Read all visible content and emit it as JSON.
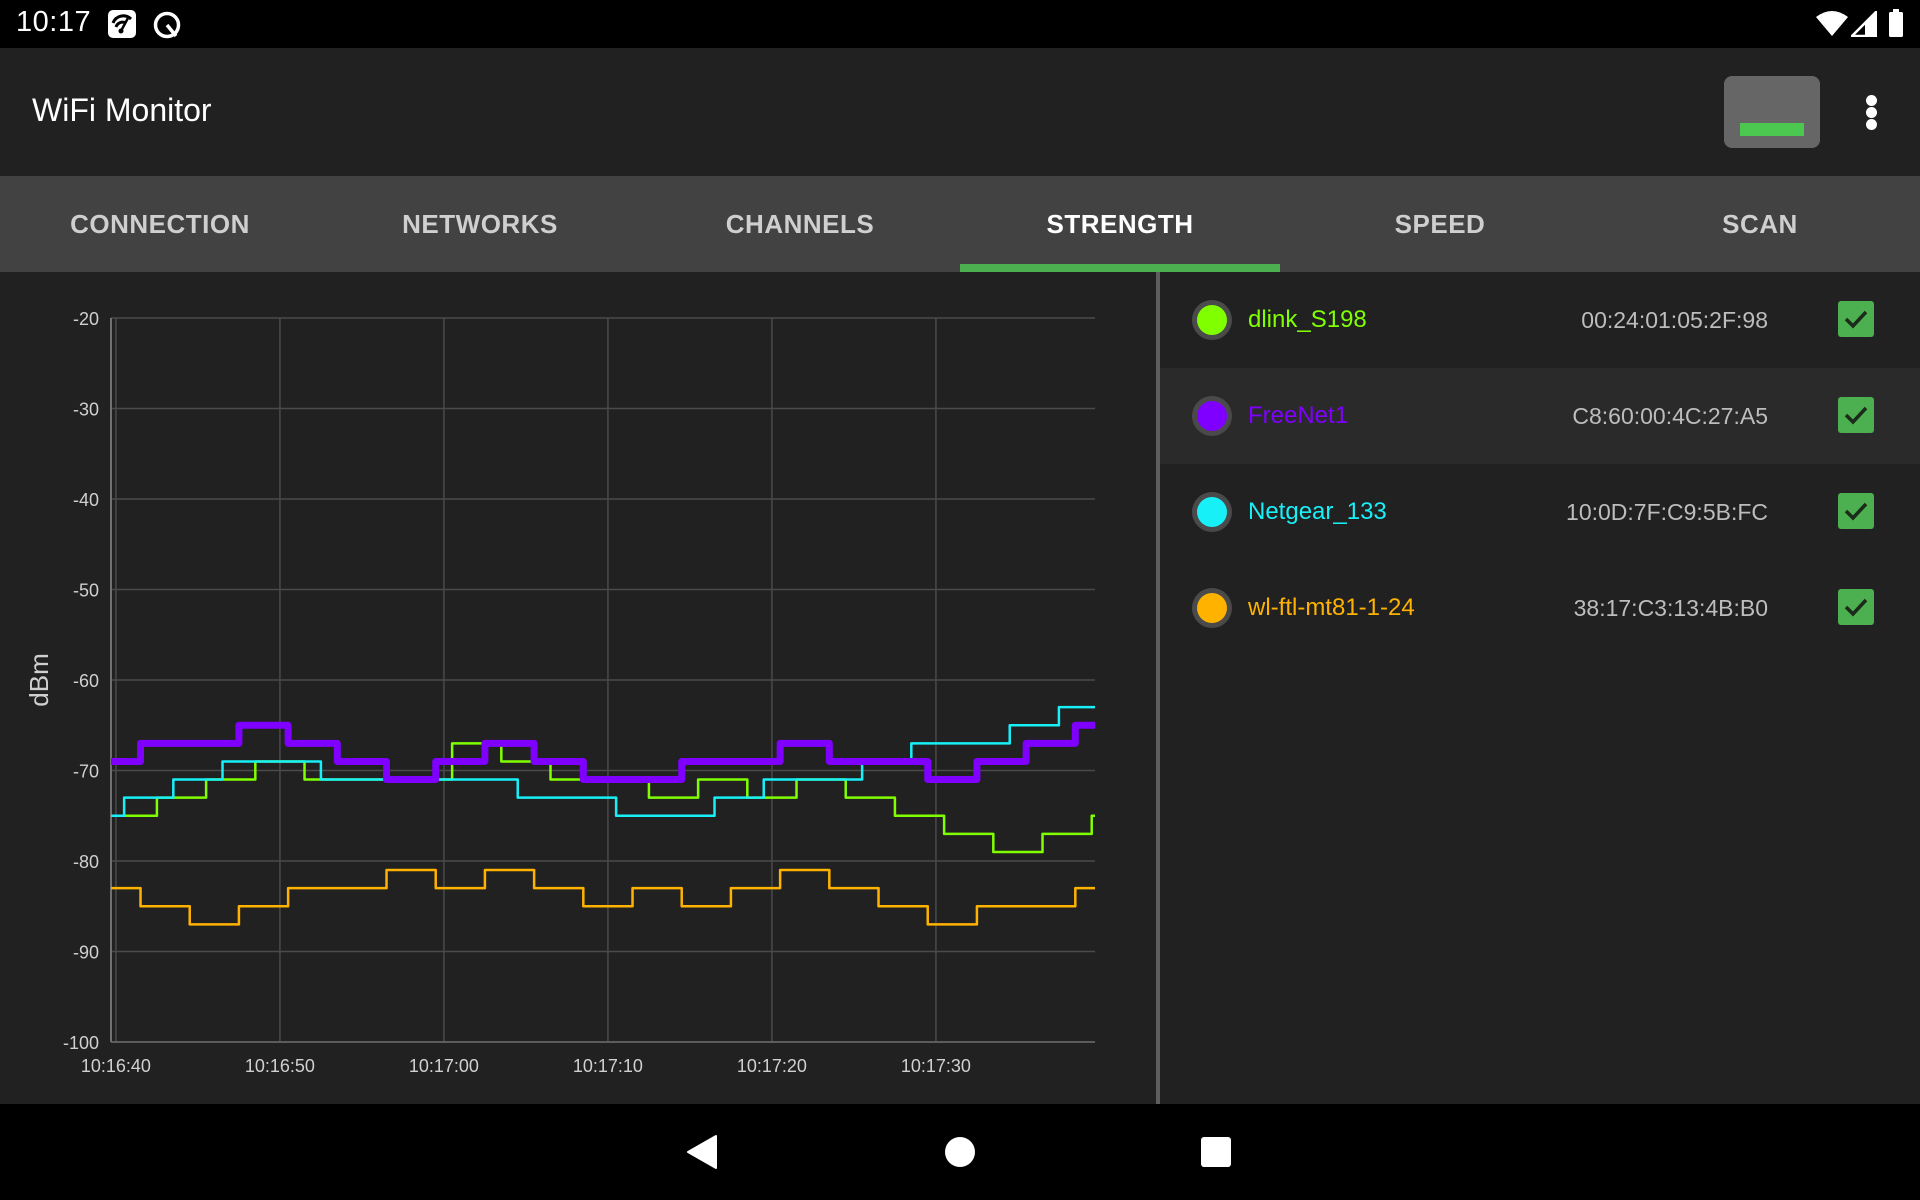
{
  "status_bar": {
    "time": "10:17",
    "left_icons": [
      "speedtest-icon",
      "q-launcher-icon"
    ],
    "right_icons": [
      "wifi-signal-icon",
      "cell-signal-icon",
      "battery-icon"
    ]
  },
  "app_bar": {
    "title": "WiFi Monitor",
    "actions": [
      {
        "name": "signal-strength-indicator",
        "icon": "strength-bar-icon",
        "accent": "#4cc850"
      },
      {
        "name": "overflow-menu",
        "icon": "more-vert-icon"
      }
    ]
  },
  "tabs": [
    {
      "label": "CONNECTION",
      "active": false
    },
    {
      "label": "NETWORKS",
      "active": false
    },
    {
      "label": "CHANNELS",
      "active": false
    },
    {
      "label": "STRENGTH",
      "active": true
    },
    {
      "label": "SPEED",
      "active": false
    },
    {
      "label": "SCAN",
      "active": false
    }
  ],
  "accent_color": "#4caf50",
  "networks": [
    {
      "ssid": "dlink_S198",
      "bssid": "00:24:01:05:2F:98",
      "color": "#80ff00",
      "checked": true,
      "highlighted": false
    },
    {
      "ssid": "FreeNet1",
      "bssid": "C8:60:00:4C:27:A5",
      "color": "#7f00ff",
      "checked": true,
      "highlighted": true
    },
    {
      "ssid": "Netgear_133",
      "bssid": "10:0D:7F:C9:5B:FC",
      "color": "#18f0f8",
      "checked": true,
      "highlighted": false
    },
    {
      "ssid": "wl-ftl-mt81-1-24",
      "bssid": "38:17:C3:13:4B:B0",
      "color": "#ffb300",
      "checked": true,
      "highlighted": false
    }
  ],
  "chart_data": {
    "type": "line",
    "step": true,
    "title": "",
    "xlabel": "",
    "ylabel": "dBm",
    "x_unit": "seconds after 10:16:40",
    "xlim": [
      -0.3,
      59.7
    ],
    "ylim": [
      -100,
      -20
    ],
    "grid": true,
    "legend": "none (see network list on right)",
    "y_ticks": [
      -20,
      -30,
      -40,
      -50,
      -60,
      -70,
      -80,
      -90,
      -100
    ],
    "x_ticks": [
      {
        "value": 0,
        "label": "10:16:40"
      },
      {
        "value": 10,
        "label": "10:16:50"
      },
      {
        "value": 20,
        "label": "10:17:00"
      },
      {
        "value": 30,
        "label": "10:17:10"
      },
      {
        "value": 40,
        "label": "10:17:20"
      },
      {
        "value": 50,
        "label": "10:17:30"
      }
    ],
    "series": [
      {
        "name": "dlink_S198",
        "color": "#80ff00",
        "bold": false,
        "points": [
          [
            -0.3,
            -75
          ],
          [
            2.5,
            -73
          ],
          [
            5.5,
            -71
          ],
          [
            8.5,
            -69
          ],
          [
            11.5,
            -71
          ],
          [
            20.5,
            -67
          ],
          [
            23.5,
            -69
          ],
          [
            26.5,
            -71
          ],
          [
            32.5,
            -73
          ],
          [
            35.5,
            -71
          ],
          [
            38.5,
            -73
          ],
          [
            41.5,
            -71
          ],
          [
            44.5,
            -73
          ],
          [
            47.5,
            -75
          ],
          [
            50.5,
            -77
          ],
          [
            53.5,
            -79
          ],
          [
            56.5,
            -77
          ],
          [
            59.5,
            -75
          ]
        ]
      },
      {
        "name": "FreeNet1",
        "color": "#7f00ff",
        "bold": true,
        "points": [
          [
            -0.3,
            -69
          ],
          [
            1.5,
            -67
          ],
          [
            7.5,
            -65
          ],
          [
            10.5,
            -67
          ],
          [
            13.5,
            -69
          ],
          [
            16.5,
            -71
          ],
          [
            19.5,
            -69
          ],
          [
            22.5,
            -67
          ],
          [
            25.5,
            -69
          ],
          [
            28.5,
            -71
          ],
          [
            34.5,
            -69
          ],
          [
            40.5,
            -67
          ],
          [
            43.5,
            -69
          ],
          [
            49.5,
            -71
          ],
          [
            52.5,
            -69
          ],
          [
            55.5,
            -67
          ],
          [
            58.5,
            -65
          ]
        ]
      },
      {
        "name": "Netgear_133",
        "color": "#18f0f8",
        "bold": false,
        "points": [
          [
            -0.3,
            -75
          ],
          [
            0.5,
            -73
          ],
          [
            3.5,
            -71
          ],
          [
            6.5,
            -69
          ],
          [
            12.5,
            -71
          ],
          [
            24.5,
            -73
          ],
          [
            30.5,
            -75
          ],
          [
            36.5,
            -73
          ],
          [
            39.5,
            -71
          ],
          [
            45.5,
            -69
          ],
          [
            48.5,
            -67
          ],
          [
            54.5,
            -65
          ],
          [
            57.5,
            -63
          ]
        ]
      },
      {
        "name": "wl-ftl-mt81-1-24",
        "color": "#ffb300",
        "bold": false,
        "points": [
          [
            -0.3,
            -83
          ],
          [
            1.5,
            -85
          ],
          [
            4.5,
            -87
          ],
          [
            7.5,
            -85
          ],
          [
            10.5,
            -83
          ],
          [
            16.5,
            -81
          ],
          [
            19.5,
            -83
          ],
          [
            22.5,
            -81
          ],
          [
            25.5,
            -83
          ],
          [
            28.5,
            -85
          ],
          [
            31.5,
            -83
          ],
          [
            34.5,
            -85
          ],
          [
            37.5,
            -83
          ],
          [
            40.5,
            -81
          ],
          [
            43.5,
            -83
          ],
          [
            46.5,
            -85
          ],
          [
            49.5,
            -87
          ],
          [
            52.5,
            -85
          ],
          [
            58.5,
            -83
          ]
        ]
      }
    ]
  },
  "nav_bar": {
    "buttons": [
      "back-icon",
      "home-icon",
      "recents-icon"
    ]
  }
}
